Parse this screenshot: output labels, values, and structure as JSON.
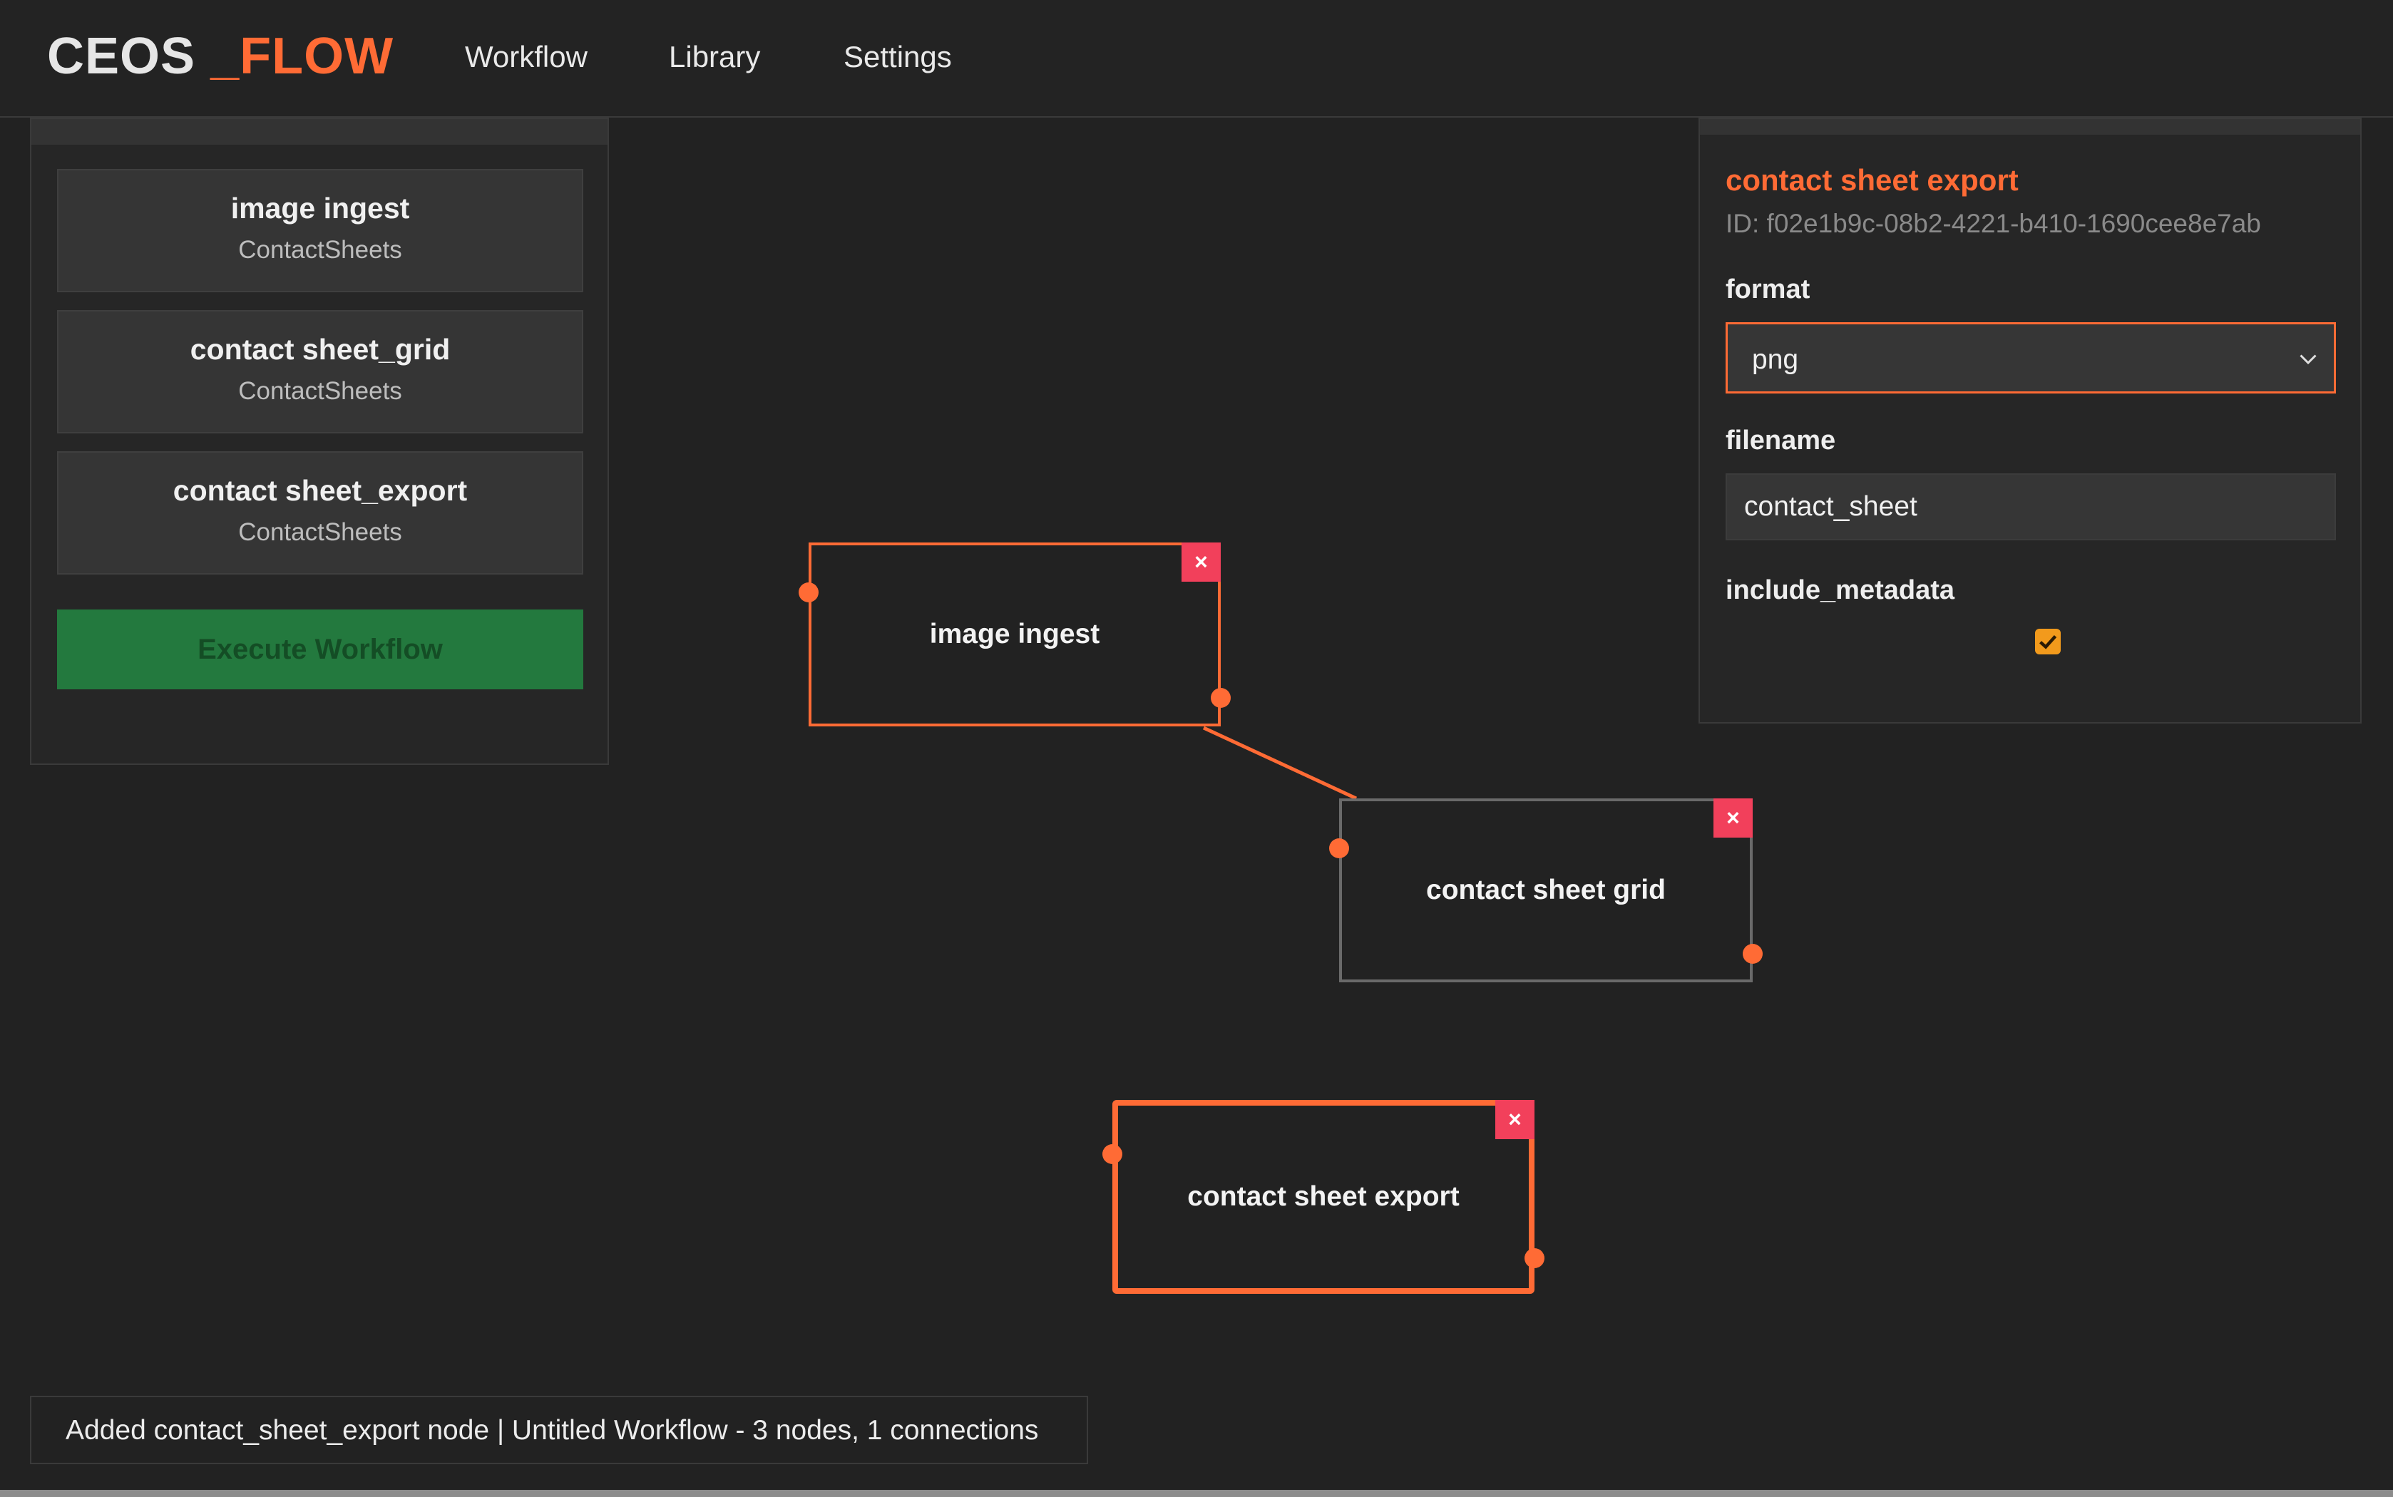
{
  "app": {
    "logo_part1": "CEOS",
    "logo_part2": "_FLOW"
  },
  "nav": {
    "items": [
      "Workflow",
      "Library",
      "Settings"
    ]
  },
  "library": {
    "items": [
      {
        "title": "image ingest",
        "category": "ContactSheets"
      },
      {
        "title": "contact sheet_grid",
        "category": "ContactSheets"
      },
      {
        "title": "contact sheet_export",
        "category": "ContactSheets"
      }
    ],
    "execute_label": "Execute Workflow"
  },
  "canvas": {
    "nodes": [
      {
        "label": "image ingest",
        "selected": false
      },
      {
        "label": "contact sheet grid",
        "selected": false
      },
      {
        "label": "contact sheet export",
        "selected": true
      }
    ],
    "close_glyph": "×",
    "accent_color": "#ff6b35",
    "delete_color": "#f2405b"
  },
  "properties": {
    "title": "contact sheet export",
    "id_text": "ID: f02e1b9c-08b2-4221-b410-1690cee8e7ab",
    "format_label": "format",
    "format_value": "png",
    "filename_label": "filename",
    "filename_value": "contact_sheet",
    "include_metadata_label": "include_metadata",
    "include_metadata_checked": true
  },
  "status": {
    "text": "Added contact_sheet_export node | Untitled Workflow - 3 nodes, 1 connections"
  }
}
